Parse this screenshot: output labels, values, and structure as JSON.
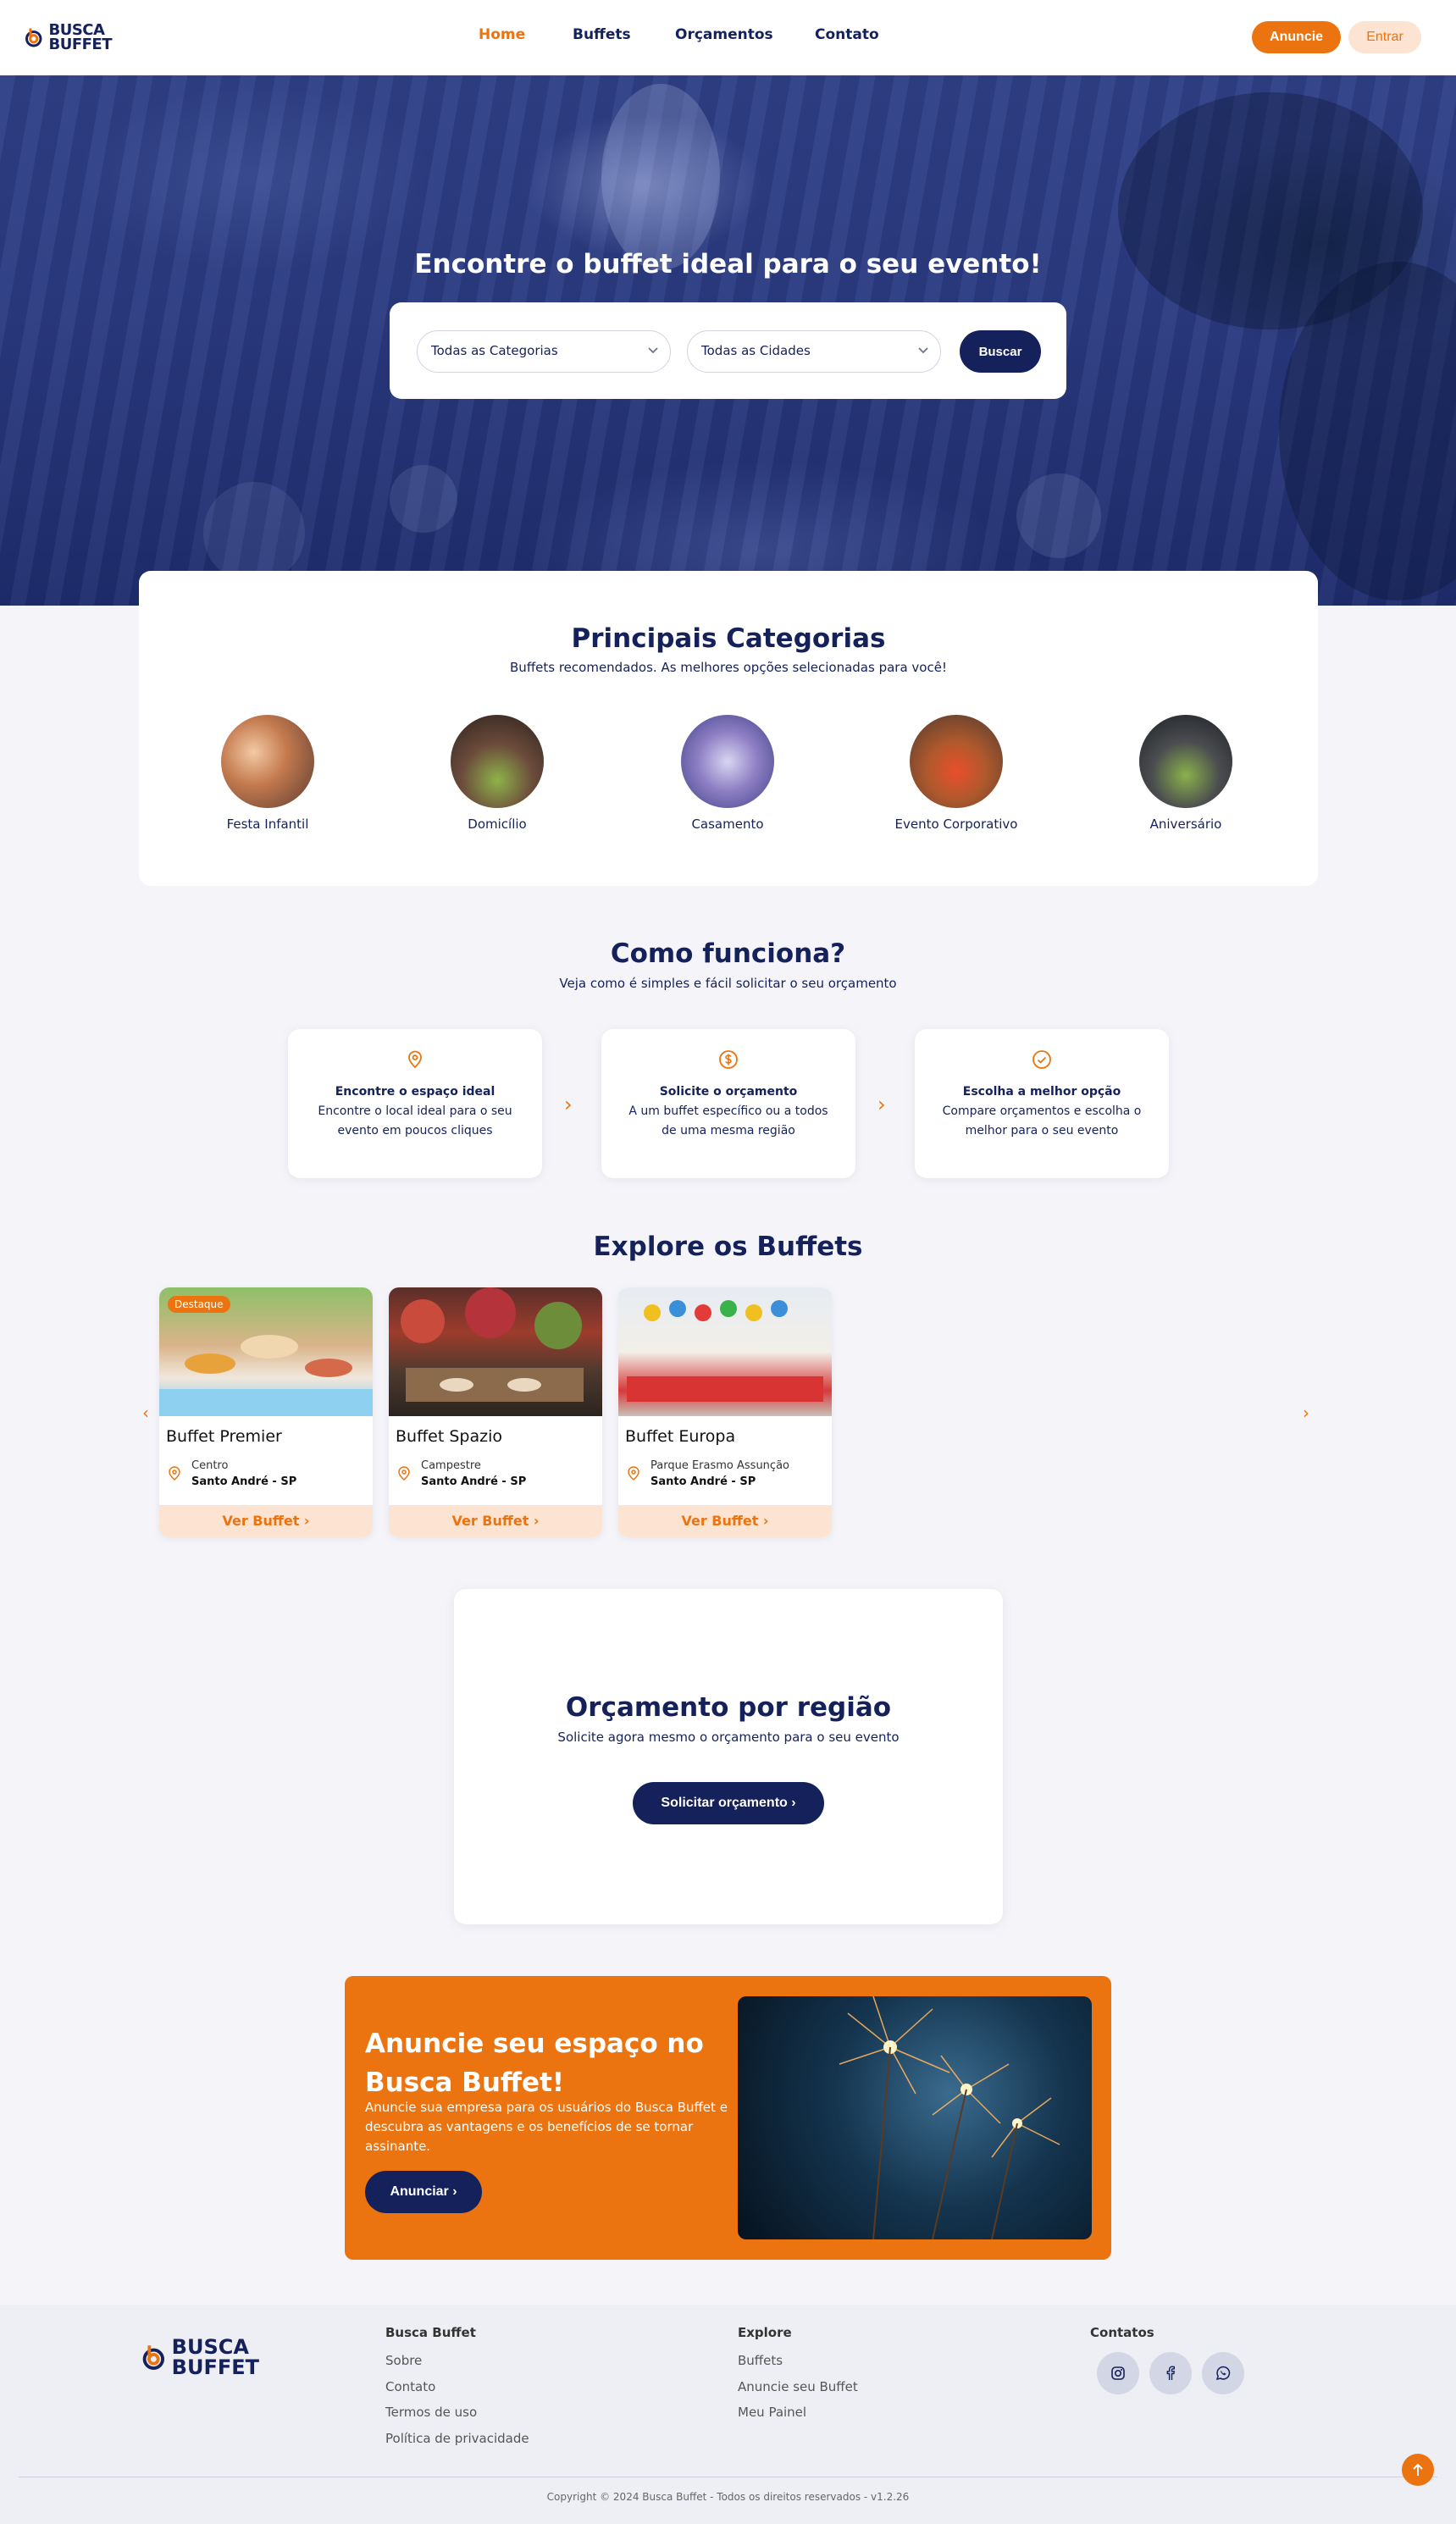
{
  "header": {
    "logo_line1": "BUSCA",
    "logo_line2": "BUFFET",
    "nav": [
      "Home",
      "Buffets",
      "Orçamentos",
      "Contato"
    ],
    "active_nav": "Home",
    "anuncie_label": "Anuncie",
    "entrar_label": "Entrar"
  },
  "hero": {
    "title": "Encontre o buffet ideal para o seu evento!",
    "category_select": "Todas as Categorias",
    "city_select": "Todas as Cidades",
    "search_label": "Buscar"
  },
  "categories": {
    "title": "Principais Categorias",
    "subtitle": "Buffets recomendados. As melhores opções selecionadas para você!",
    "items": [
      "Festa Infantil",
      "Domicílio",
      "Casamento",
      "Evento Corporativo",
      "Aniversário"
    ]
  },
  "how": {
    "title": "Como funciona?",
    "subtitle": "Veja como é simples e fácil solicitar o seu orçamento",
    "steps": [
      {
        "title": "Encontre o espaço ideal",
        "text": "Encontre o local ideal para o seu evento em poucos cliques",
        "icon": "map-pin-icon"
      },
      {
        "title": "Solicite o orçamento",
        "text": "A um buffet específico ou a todos de uma mesma região",
        "icon": "dollar-icon"
      },
      {
        "title": "Escolha a melhor opção",
        "text": "Compare orçamentos e escolha o melhor para o seu evento",
        "icon": "check-circle-icon"
      }
    ]
  },
  "buffets": {
    "title": "Explore os Buffets",
    "badge": "Destaque",
    "cta": "Ver Buffet",
    "items": [
      {
        "name": "Buffet Premier",
        "district": "Centro",
        "city": "Santo André - SP"
      },
      {
        "name": "Buffet Spazio",
        "district": "Campestre",
        "city": "Santo André - SP"
      },
      {
        "name": "Buffet Europa",
        "district": "Parque Erasmo Assunção",
        "city": "Santo André - SP"
      }
    ]
  },
  "orcamento": {
    "title": "Orçamento por região",
    "subtitle": "Solicite agora mesmo o orçamento para o seu evento",
    "button": "Solicitar orçamento"
  },
  "ad": {
    "title": "Anuncie seu espaço no Busca Buffet!",
    "text": "Anuncie sua empresa para os usuários do Busca Buffet e descubra as vantagens e os benefícios de se tornar assinante.",
    "button": "Anunciar"
  },
  "footer": {
    "col1_title": "Busca Buffet",
    "col1_links": [
      "Sobre",
      "Contato",
      "Termos de uso",
      "Política de privacidade"
    ],
    "col2_title": "Explore",
    "col2_links": [
      "Buffets",
      "Anuncie seu Buffet",
      "Meu Painel"
    ],
    "col3_title": "Contatos",
    "social": [
      "instagram-icon",
      "facebook-icon",
      "whatsapp-icon"
    ],
    "copyright": "Copyright © 2024 Busca Buffet - Todos os direitos reservados - v1.2.26"
  },
  "colors": {
    "brand_orange": "#ec7410",
    "brand_navy": "#14215a",
    "background": "#f5f5f9"
  }
}
